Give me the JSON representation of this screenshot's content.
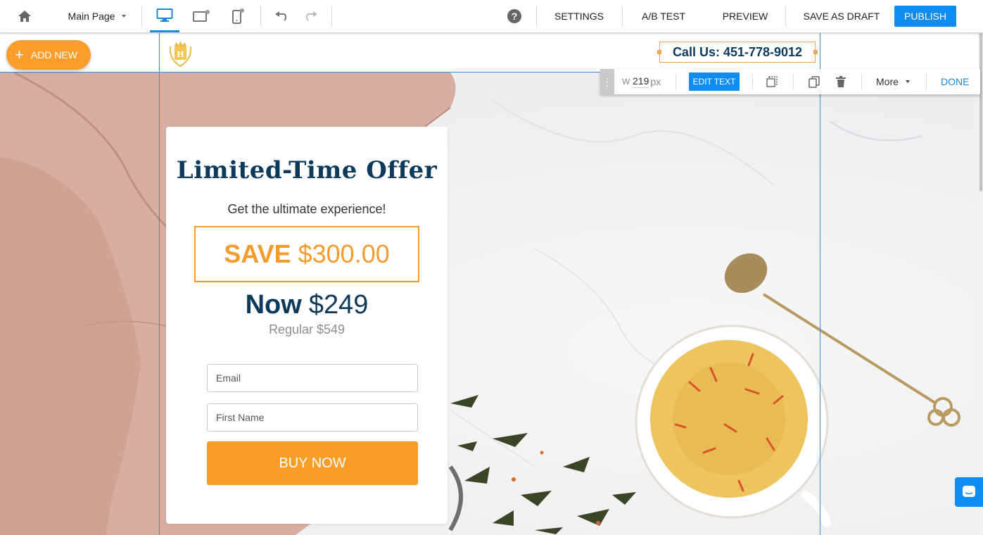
{
  "toolbar": {
    "page_selector": "Main Page",
    "settings": "SETTINGS",
    "ab_test": "A/B TEST",
    "preview": "PREVIEW",
    "save_draft": "SAVE AS DRAFT",
    "publish": "PUBLISH",
    "active_device": "desktop",
    "accent_color": "#0e8cf0"
  },
  "editor": {
    "add_new": "ADD NEW",
    "width_label": "W",
    "width_value": "219",
    "width_unit": "px",
    "edit_text": "EDIT TEXT",
    "more": "More",
    "done": "DONE"
  },
  "page": {
    "call_us": "Call Us: 451-778-9012",
    "brand_color": "#0b3a5c",
    "offer_color": "#f39c2e"
  },
  "offer": {
    "title": "Limited-Time Offer",
    "subtitle": "Get the ultimate experience!",
    "save_label": "SAVE",
    "save_amount": "$300.00",
    "now_label": "Now",
    "now_price": "$249",
    "regular": "Regular $549",
    "email_placeholder": "Email",
    "first_name_placeholder": "First Name",
    "buy_button": "BUY NOW"
  }
}
